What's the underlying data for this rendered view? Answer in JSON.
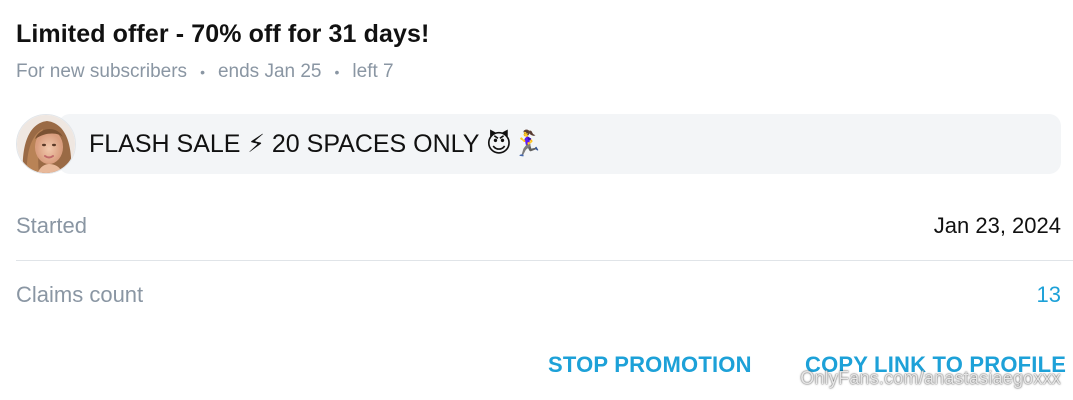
{
  "offer": {
    "title": "Limited offer - 70% off for 31 days!",
    "audience": "For new subscribers",
    "ends": "ends Jan 25",
    "left": "left 7",
    "separator": "•"
  },
  "message": {
    "text": "FLASH SALE ⚡ 20 SPACES ONLY 😈🏃‍♀️",
    "avatar_icon": "profile-photo-avatar"
  },
  "details": {
    "started_label": "Started",
    "started_value": "Jan 23, 2024",
    "claims_label": "Claims count",
    "claims_value": "13"
  },
  "actions": {
    "stop_label": "STOP PROMOTION",
    "copy_label": "COPY LINK TO PROFILE"
  },
  "watermark": "OnlyFans.com/anastasiaegoxxx",
  "colors": {
    "accent": "#1da1d8",
    "muted": "#8a96a3",
    "bubble_bg": "#f3f5f7",
    "divider": "#e0e4e8"
  }
}
